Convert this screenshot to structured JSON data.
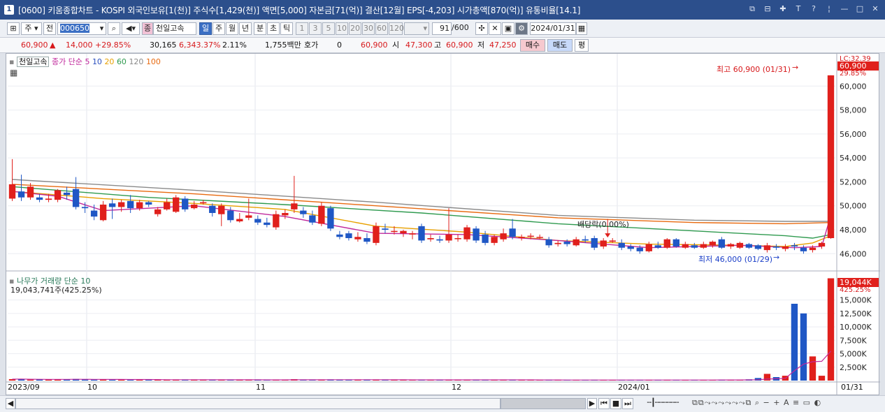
{
  "window": {
    "title": "[0600] 키움종합차트 - KOSPI 외국인보유[1(천)] 주식수[1,429(천)] 액면[5,000] 자본금[71(억)] 결산[12월] EPS[-4,203] 시가총액[870(억)] 유통비율[14.1]",
    "app_number": "1"
  },
  "toolbar": {
    "period_label": "주",
    "prev_label": "전",
    "code": "000650",
    "stock_name": "천일고속",
    "stock_badge": "종",
    "period_buttons": [
      "일",
      "주",
      "월",
      "년",
      "분",
      "초",
      "틱"
    ],
    "interval_buttons": [
      "1",
      "3",
      "5",
      "10",
      "20",
      "30",
      "60",
      "120"
    ],
    "count": "91",
    "count_total": "/600",
    "date": "2024/01/31"
  },
  "infobar": {
    "price": "60,900",
    "change": "14,000",
    "change_pct": "+29.85%",
    "volume": "30,165",
    "volume_pct": "6,343.37%",
    "turnover": "2.11%",
    "amount": "1,755백만",
    "hoga_label": "호가",
    "hoga_value": "0",
    "ask": "60,900",
    "open_label": "시",
    "open": "47,300",
    "high_label": "고",
    "high": "60,900",
    "low_label": "저",
    "low": "47,250",
    "buy_label": "매수",
    "sell_label": "매도",
    "eval_label": "평"
  },
  "price_panel": {
    "legend_name": "천일고속",
    "legend_ma": "종가 단순",
    "ma_periods": [
      "5",
      "10",
      "20",
      "60",
      "120",
      "100"
    ],
    "ma_colors": [
      "#c0289c",
      "#2a4fbf",
      "#e8a000",
      "#2f9a4f",
      "#8a8a8a",
      "#e86a10"
    ],
    "high_note": "최고 60,900 (01/31)",
    "low_note": "최저 46,000 (01/29)",
    "dividend_note": "배당락(0.00%)",
    "lc_note": "LC:32.39",
    "price_tag": "60,900",
    "pct_tag": "29.85%"
  },
  "volume_panel": {
    "legend": "나무가 거래량  단순 10",
    "value_text": "19,043,741주(425.25%)",
    "tag_value": "19,044K",
    "tag_pct": "425.25%"
  },
  "x_axis": {
    "labels": [
      "2023/09",
      "10",
      "11",
      "12",
      "2024/01"
    ],
    "current": "01/31"
  },
  "colors": {
    "up": "#e0201c",
    "down": "#1f57c5",
    "accent_title": "#2c4f8c"
  },
  "chart_data": {
    "type": "candlestick",
    "price_axis": {
      "ticks": [
        46000,
        48000,
        50000,
        52000,
        54000,
        56000,
        58000,
        60000
      ],
      "range": [
        45200,
        62000
      ]
    },
    "volume_axis": {
      "ticks": [
        2500,
        5000,
        7500,
        10000,
        12500,
        15000
      ],
      "unit": "K",
      "range": [
        0,
        19500
      ]
    },
    "candles": [
      {
        "o": 50600,
        "c": 51800,
        "h": 53900,
        "l": 50400,
        "v": 260
      },
      {
        "o": 51200,
        "c": 50700,
        "h": 52600,
        "l": 50400,
        "v": 300
      },
      {
        "o": 50700,
        "c": 51600,
        "h": 51900,
        "l": 50500,
        "v": 180
      },
      {
        "o": 50700,
        "c": 50500,
        "h": 51000,
        "l": 50300,
        "v": 200
      },
      {
        "o": 50500,
        "c": 50600,
        "h": 51000,
        "l": 50300,
        "v": 190
      },
      {
        "o": 50500,
        "c": 51300,
        "h": 51400,
        "l": 50300,
        "v": 210
      },
      {
        "o": 51100,
        "c": 50900,
        "h": 51600,
        "l": 50500,
        "v": 240
      },
      {
        "o": 51400,
        "c": 49900,
        "h": 52400,
        "l": 49700,
        "v": 310
      },
      {
        "o": 49900,
        "c": 49800,
        "h": 50300,
        "l": 49400,
        "v": 190
      },
      {
        "o": 49600,
        "c": 49100,
        "h": 50100,
        "l": 48800,
        "v": 170
      },
      {
        "o": 48800,
        "c": 50100,
        "h": 50400,
        "l": 48700,
        "v": 200
      },
      {
        "o": 50200,
        "c": 49900,
        "h": 50600,
        "l": 48900,
        "v": 160
      },
      {
        "o": 49900,
        "c": 50300,
        "h": 50500,
        "l": 49500,
        "v": 150
      },
      {
        "o": 50400,
        "c": 49800,
        "h": 50900,
        "l": 49400,
        "v": 170
      },
      {
        "o": 49800,
        "c": 50300,
        "h": 50500,
        "l": 49600,
        "v": 160
      },
      {
        "o": 50300,
        "c": 50100,
        "h": 50400,
        "l": 49900,
        "v": 140
      },
      {
        "o": 49300,
        "c": 49700,
        "h": 49900,
        "l": 49100,
        "v": 130
      },
      {
        "o": 49700,
        "c": 50300,
        "h": 50600,
        "l": 49600,
        "v": 150
      },
      {
        "o": 49500,
        "c": 50700,
        "h": 50900,
        "l": 49400,
        "v": 160
      },
      {
        "o": 50600,
        "c": 49700,
        "h": 50800,
        "l": 49500,
        "v": 170
      },
      {
        "o": 49800,
        "c": 50100,
        "h": 50400,
        "l": 49700,
        "v": 140
      },
      {
        "o": 50300,
        "c": 50300,
        "h": 50500,
        "l": 50100,
        "v": 120
      },
      {
        "o": 50000,
        "c": 49400,
        "h": 50200,
        "l": 49100,
        "v": 130
      },
      {
        "o": 49300,
        "c": 50000,
        "h": 50200,
        "l": 48300,
        "v": 150
      },
      {
        "o": 49600,
        "c": 48800,
        "h": 49900,
        "l": 48600,
        "v": 120
      },
      {
        "o": 48700,
        "c": 48900,
        "h": 49400,
        "l": 48600,
        "v": 110
      },
      {
        "o": 49000,
        "c": 49200,
        "h": 50600,
        "l": 48800,
        "v": 140
      },
      {
        "o": 48900,
        "c": 48600,
        "h": 49200,
        "l": 48400,
        "v": 130
      },
      {
        "o": 48600,
        "c": 48400,
        "h": 49000,
        "l": 48200,
        "v": 120
      },
      {
        "o": 48200,
        "c": 49300,
        "h": 49600,
        "l": 48000,
        "v": 150
      },
      {
        "o": 49200,
        "c": 49400,
        "h": 49700,
        "l": 48900,
        "v": 110
      },
      {
        "o": 49700,
        "c": 50200,
        "h": 52500,
        "l": 49400,
        "v": 260
      },
      {
        "o": 49600,
        "c": 49300,
        "h": 49900,
        "l": 49000,
        "v": 140
      },
      {
        "o": 49200,
        "c": 48600,
        "h": 49600,
        "l": 48400,
        "v": 130
      },
      {
        "o": 48500,
        "c": 50000,
        "h": 50300,
        "l": 48300,
        "v": 170
      },
      {
        "o": 49800,
        "c": 48100,
        "h": 50000,
        "l": 47900,
        "v": 210
      },
      {
        "o": 47600,
        "c": 47400,
        "h": 47900,
        "l": 47200,
        "v": 140
      },
      {
        "o": 47700,
        "c": 47300,
        "h": 47900,
        "l": 47100,
        "v": 120
      },
      {
        "o": 47200,
        "c": 47400,
        "h": 47800,
        "l": 47000,
        "v": 110
      },
      {
        "o": 47300,
        "c": 47000,
        "h": 47700,
        "l": 46800,
        "v": 130
      },
      {
        "o": 46900,
        "c": 48300,
        "h": 48600,
        "l": 46700,
        "v": 180
      },
      {
        "o": 48100,
        "c": 48000,
        "h": 48500,
        "l": 47700,
        "v": 140
      },
      {
        "o": 47900,
        "c": 47900,
        "h": 48300,
        "l": 47600,
        "v": 120
      },
      {
        "o": 47700,
        "c": 47900,
        "h": 48000,
        "l": 47400,
        "v": 110
      },
      {
        "o": 47600,
        "c": 47700,
        "h": 47900,
        "l": 47200,
        "v": 100
      },
      {
        "o": 48300,
        "c": 47100,
        "h": 48500,
        "l": 46900,
        "v": 160
      },
      {
        "o": 47200,
        "c": 47300,
        "h": 47600,
        "l": 47000,
        "v": 110
      },
      {
        "o": 47200,
        "c": 47100,
        "h": 47500,
        "l": 46900,
        "v": 100
      },
      {
        "o": 47100,
        "c": 47600,
        "h": 49800,
        "l": 46900,
        "v": 170
      },
      {
        "o": 47300,
        "c": 47300,
        "h": 47600,
        "l": 47000,
        "v": 100
      },
      {
        "o": 47200,
        "c": 48200,
        "h": 48400,
        "l": 47000,
        "v": 150
      },
      {
        "o": 48100,
        "c": 47100,
        "h": 48300,
        "l": 46900,
        "v": 140
      },
      {
        "o": 47600,
        "c": 46900,
        "h": 47900,
        "l": 46700,
        "v": 120
      },
      {
        "o": 46900,
        "c": 47400,
        "h": 47600,
        "l": 46700,
        "v": 110
      },
      {
        "o": 47200,
        "c": 47700,
        "h": 48100,
        "l": 47000,
        "v": 120
      },
      {
        "o": 48100,
        "c": 47400,
        "h": 48900,
        "l": 47200,
        "v": 150
      },
      {
        "o": 47300,
        "c": 47400,
        "h": 47600,
        "l": 47100,
        "v": 100
      },
      {
        "o": 47500,
        "c": 47500,
        "h": 47700,
        "l": 47200,
        "v": 90
      },
      {
        "o": 47400,
        "c": 47400,
        "h": 47600,
        "l": 47200,
        "v": 90
      },
      {
        "o": 47200,
        "c": 46700,
        "h": 47400,
        "l": 46500,
        "v": 110
      },
      {
        "o": 46800,
        "c": 46900,
        "h": 47100,
        "l": 46600,
        "v": 90
      },
      {
        "o": 47000,
        "c": 46800,
        "h": 47200,
        "l": 46600,
        "v": 90
      },
      {
        "o": 46700,
        "c": 47200,
        "h": 47400,
        "l": 46600,
        "v": 100
      },
      {
        "o": 47200,
        "c": 47100,
        "h": 47500,
        "l": 46900,
        "v": 90
      },
      {
        "o": 47300,
        "c": 46500,
        "h": 47500,
        "l": 46300,
        "v": 140
      },
      {
        "o": 46600,
        "c": 47100,
        "h": 47300,
        "l": 46400,
        "v": 110
      },
      {
        "o": 47000,
        "c": 47100,
        "h": 47300,
        "l": 46900,
        "v": 90
      },
      {
        "o": 46900,
        "c": 46500,
        "h": 47200,
        "l": 46300,
        "v": 100
      },
      {
        "o": 46600,
        "c": 46400,
        "h": 46800,
        "l": 46200,
        "v": 90
      },
      {
        "o": 46500,
        "c": 46200,
        "h": 46700,
        "l": 46000,
        "v": 110
      },
      {
        "o": 46200,
        "c": 46800,
        "h": 47000,
        "l": 46100,
        "v": 130
      },
      {
        "o": 46700,
        "c": 46500,
        "h": 47000,
        "l": 46400,
        "v": 90
      },
      {
        "o": 46500,
        "c": 47200,
        "h": 47300,
        "l": 46400,
        "v": 140
      },
      {
        "o": 47200,
        "c": 46600,
        "h": 47300,
        "l": 46500,
        "v": 100
      },
      {
        "o": 46500,
        "c": 46800,
        "h": 47000,
        "l": 46400,
        "v": 90
      },
      {
        "o": 46700,
        "c": 46500,
        "h": 46900,
        "l": 46400,
        "v": 80
      },
      {
        "o": 46500,
        "c": 46800,
        "h": 47000,
        "l": 46400,
        "v": 100
      },
      {
        "o": 46700,
        "c": 47000,
        "h": 47100,
        "l": 46500,
        "v": 120
      },
      {
        "o": 47200,
        "c": 46500,
        "h": 47400,
        "l": 46400,
        "v": 160
      },
      {
        "o": 46600,
        "c": 46800,
        "h": 46900,
        "l": 46400,
        "v": 120
      },
      {
        "o": 46500,
        "c": 46900,
        "h": 47000,
        "l": 46400,
        "v": 140
      },
      {
        "o": 46800,
        "c": 46500,
        "h": 46900,
        "l": 46400,
        "v": 230
      },
      {
        "o": 46700,
        "c": 46400,
        "h": 46800,
        "l": 46300,
        "v": 480
      },
      {
        "o": 46300,
        "c": 46700,
        "h": 46900,
        "l": 46100,
        "v": 1250
      },
      {
        "o": 46600,
        "c": 46500,
        "h": 46800,
        "l": 46300,
        "v": 650
      },
      {
        "o": 46400,
        "c": 46600,
        "h": 46800,
        "l": 46200,
        "v": 900
      },
      {
        "o": 46700,
        "c": 46600,
        "h": 46900,
        "l": 46300,
        "v": 14300
      },
      {
        "o": 46500,
        "c": 46200,
        "h": 46700,
        "l": 46000,
        "v": 12500
      },
      {
        "o": 46300,
        "c": 46500,
        "h": 46700,
        "l": 46100,
        "v": 4500
      },
      {
        "o": 46600,
        "c": 46900,
        "h": 47000,
        "l": 46400,
        "v": 900
      },
      {
        "o": 47300,
        "c": 60900,
        "h": 60900,
        "l": 47250,
        "v": 19044
      }
    ],
    "ma": [
      {
        "period": "20",
        "color": "#e8a000",
        "values": [
          [
            0,
            51200
          ],
          [
            10,
            50600
          ],
          [
            20,
            50200
          ],
          [
            30,
            49700
          ],
          [
            40,
            48300
          ],
          [
            50,
            47800
          ],
          [
            60,
            47100
          ],
          [
            70,
            46800
          ],
          [
            80,
            46700
          ],
          [
            85,
            46600
          ],
          [
            88,
            46900
          ],
          [
            90,
            47500
          ]
        ]
      },
      {
        "period": "60",
        "color": "#2f9a4f",
        "values": [
          [
            0,
            51600
          ],
          [
            15,
            50700
          ],
          [
            30,
            50100
          ],
          [
            45,
            49400
          ],
          [
            60,
            48500
          ],
          [
            75,
            47900
          ],
          [
            85,
            47500
          ],
          [
            88,
            47300
          ],
          [
            90,
            47600
          ]
        ]
      },
      {
        "period": "120",
        "color": "#8a8a8a",
        "values": [
          [
            0,
            52200
          ],
          [
            20,
            51300
          ],
          [
            40,
            50300
          ],
          [
            60,
            49200
          ],
          [
            75,
            48800
          ],
          [
            85,
            48700
          ],
          [
            90,
            48700
          ]
        ]
      },
      {
        "period": "100",
        "color": "#e86a10",
        "values": [
          [
            0,
            51800
          ],
          [
            20,
            51000
          ],
          [
            40,
            50000
          ],
          [
            60,
            49000
          ],
          [
            75,
            48600
          ],
          [
            85,
            48500
          ],
          [
            90,
            48600
          ]
        ]
      },
      {
        "period": "5",
        "color": "#c0289c",
        "values": [
          [
            0,
            51200
          ],
          [
            5,
            50800
          ],
          [
            10,
            49600
          ],
          [
            20,
            50000
          ],
          [
            30,
            49100
          ],
          [
            40,
            47700
          ],
          [
            50,
            47600
          ],
          [
            60,
            47100
          ],
          [
            70,
            46500
          ],
          [
            80,
            46700
          ],
          [
            86,
            46500
          ],
          [
            89,
            46600
          ],
          [
            90,
            49200
          ]
        ]
      }
    ]
  }
}
